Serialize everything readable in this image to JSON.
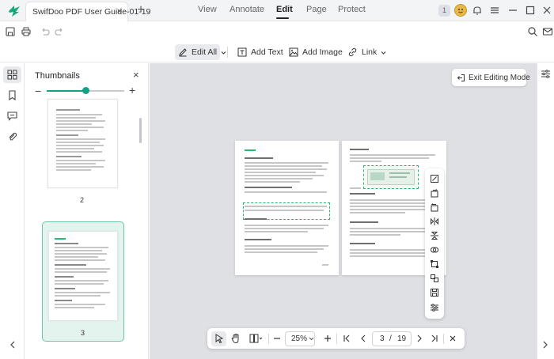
{
  "window": {
    "doc_tab_title": "SwifDoo PDF User Guide-01-19",
    "close_glyph": "×",
    "new_tab_glyph": "+",
    "badge_count": "1",
    "icons": [
      "notification-bell-icon",
      "hamburger-menu-icon",
      "minimize-icon",
      "maximize-icon",
      "window-close-icon"
    ]
  },
  "menu": {
    "tabs": [
      {
        "label": "View",
        "active": false
      },
      {
        "label": "Annotate",
        "active": false
      },
      {
        "label": "Edit",
        "active": true
      },
      {
        "label": "Page",
        "active": false
      },
      {
        "label": "Protect",
        "active": false
      }
    ]
  },
  "toolbar": {
    "edit_all": "Edit All",
    "add_text": "Add Text",
    "add_image": "Add Image",
    "link": "Link"
  },
  "thumbnails": {
    "title": "Thumbnails",
    "close_glyph": "×",
    "zoom_minus": "−",
    "zoom_plus": "+",
    "zoom_level": 0.5,
    "pages": [
      {
        "number": "2",
        "selected": false
      },
      {
        "number": "3",
        "selected": true
      }
    ]
  },
  "workspace": {
    "exit_editing": "Exit Editing Mode"
  },
  "nav": {
    "zoom": "25%",
    "current_page": "3",
    "separator": "/",
    "total_pages": "19"
  },
  "colors": {
    "accent": "#16a085",
    "edit_outline": "#2bb673",
    "workspace_bg": "#dfe0e4"
  }
}
